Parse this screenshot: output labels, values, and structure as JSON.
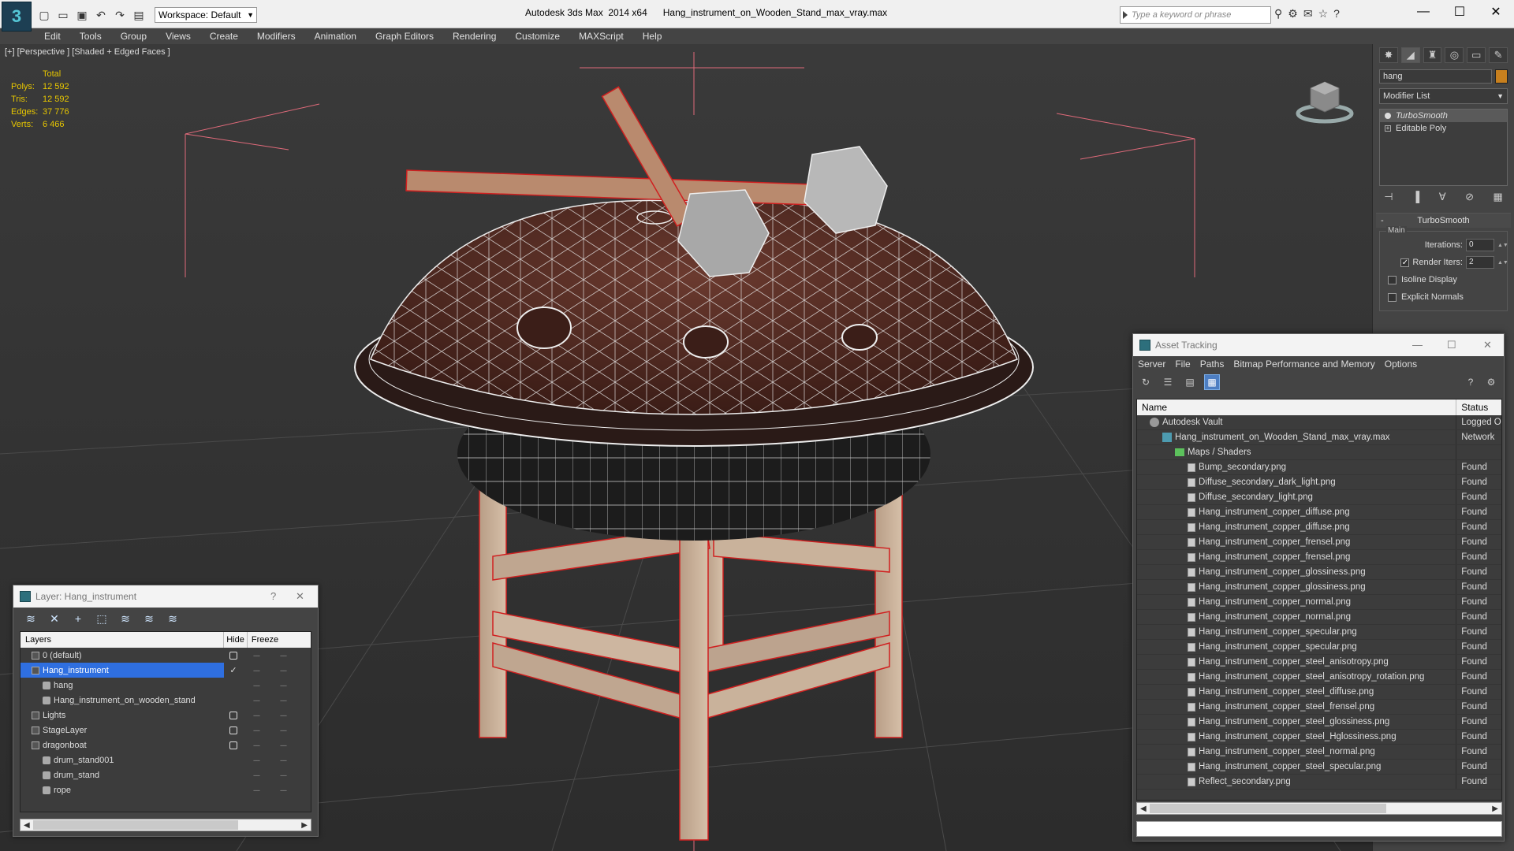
{
  "app": {
    "logo": "3",
    "workspace": "Workspace: Default",
    "title": "Autodesk 3ds Max  2014 x64      Hang_instrument_on_Wooden_Stand_max_vray.max",
    "search_placeholder": "Type a keyword or phrase"
  },
  "menu": [
    "Edit",
    "Tools",
    "Group",
    "Views",
    "Create",
    "Modifiers",
    "Animation",
    "Graph Editors",
    "Rendering",
    "Customize",
    "MAXScript",
    "Help"
  ],
  "viewport": {
    "label": "[+] [Perspective ] [Shaded + Edged Faces ]",
    "stats_header": "Total",
    "stats": [
      {
        "k": "Polys:",
        "v": "12 592"
      },
      {
        "k": "Tris:",
        "v": "12 592"
      },
      {
        "k": "Edges:",
        "v": "37 776"
      },
      {
        "k": "Verts:",
        "v": "6 466"
      }
    ]
  },
  "command_panel": {
    "object_name": "hang",
    "modifier_list": "Modifier List",
    "stack": [
      {
        "label": "TurboSmooth",
        "selected": true
      },
      {
        "label": "Editable Poly",
        "selected": false
      }
    ],
    "rollout_title": "TurboSmooth",
    "group_title": "Main",
    "iterations_label": "Iterations:",
    "iterations_value": "0",
    "render_iters_label": "Render Iters:",
    "render_iters_value": "2",
    "isoline_label": "Isoline Display",
    "explicit_normals_label": "Explicit Normals",
    "color_swatch": "#c8801e"
  },
  "layer_window": {
    "title": "Layer: Hang_instrument",
    "help": "?",
    "close": "✕",
    "col_layers": "Layers",
    "col_hide": "Hide",
    "col_freeze": "Freeze",
    "rows": [
      {
        "name": "0 (default)",
        "indent": 1,
        "type": "layer",
        "selected": false,
        "box": true
      },
      {
        "name": "Hang_instrument",
        "indent": 1,
        "type": "layer",
        "selected": true,
        "box": false,
        "check": true
      },
      {
        "name": "hang",
        "indent": 2,
        "type": "object",
        "selected": false,
        "box": false
      },
      {
        "name": "Hang_instrument_on_wooden_stand",
        "indent": 2,
        "type": "object",
        "selected": false,
        "box": false
      },
      {
        "name": "Lights",
        "indent": 1,
        "type": "layer",
        "selected": false,
        "box": true
      },
      {
        "name": "StageLayer",
        "indent": 1,
        "type": "layer",
        "selected": false,
        "box": true
      },
      {
        "name": "dragonboat",
        "indent": 1,
        "type": "layer",
        "selected": false,
        "box": true
      },
      {
        "name": "drum_stand001",
        "indent": 2,
        "type": "object",
        "selected": false,
        "box": false
      },
      {
        "name": "drum_stand",
        "indent": 2,
        "type": "object",
        "selected": false,
        "box": false
      },
      {
        "name": "rope",
        "indent": 2,
        "type": "object",
        "selected": false,
        "box": false
      }
    ]
  },
  "asset_window": {
    "title": "Asset Tracking",
    "menu": [
      "Server",
      "File",
      "Paths",
      "Bitmap Performance and Memory",
      "Options"
    ],
    "col_name": "Name",
    "col_status": "Status",
    "rows": [
      {
        "name": "Autodesk Vault",
        "status": "Logged O",
        "indent": 1,
        "icon": "vault"
      },
      {
        "name": "Hang_instrument_on_Wooden_Stand_max_vray.max",
        "status": "Network",
        "indent": 2,
        "icon": "max"
      },
      {
        "name": "Maps / Shaders",
        "status": "",
        "indent": 3,
        "icon": "group"
      },
      {
        "name": "Bump_secondary.png",
        "status": "Found",
        "indent": 4,
        "icon": "file"
      },
      {
        "name": "Diffuse_secondary_dark_light.png",
        "status": "Found",
        "indent": 4,
        "icon": "file"
      },
      {
        "name": "Diffuse_secondary_light.png",
        "status": "Found",
        "indent": 4,
        "icon": "file"
      },
      {
        "name": "Hang_instrument_copper_diffuse.png",
        "status": "Found",
        "indent": 4,
        "icon": "file"
      },
      {
        "name": "Hang_instrument_copper_diffuse.png",
        "status": "Found",
        "indent": 4,
        "icon": "file"
      },
      {
        "name": "Hang_instrument_copper_frensel.png",
        "status": "Found",
        "indent": 4,
        "icon": "file"
      },
      {
        "name": "Hang_instrument_copper_frensel.png",
        "status": "Found",
        "indent": 4,
        "icon": "file"
      },
      {
        "name": "Hang_instrument_copper_glossiness.png",
        "status": "Found",
        "indent": 4,
        "icon": "file"
      },
      {
        "name": "Hang_instrument_copper_glossiness.png",
        "status": "Found",
        "indent": 4,
        "icon": "file"
      },
      {
        "name": "Hang_instrument_copper_normal.png",
        "status": "Found",
        "indent": 4,
        "icon": "file"
      },
      {
        "name": "Hang_instrument_copper_normal.png",
        "status": "Found",
        "indent": 4,
        "icon": "file"
      },
      {
        "name": "Hang_instrument_copper_specular.png",
        "status": "Found",
        "indent": 4,
        "icon": "file"
      },
      {
        "name": "Hang_instrument_copper_specular.png",
        "status": "Found",
        "indent": 4,
        "icon": "file"
      },
      {
        "name": "Hang_instrument_copper_steel_anisotropy.png",
        "status": "Found",
        "indent": 4,
        "icon": "file"
      },
      {
        "name": "Hang_instrument_copper_steel_anisotropy_rotation.png",
        "status": "Found",
        "indent": 4,
        "icon": "file"
      },
      {
        "name": "Hang_instrument_copper_steel_diffuse.png",
        "status": "Found",
        "indent": 4,
        "icon": "file"
      },
      {
        "name": "Hang_instrument_copper_steel_frensel.png",
        "status": "Found",
        "indent": 4,
        "icon": "file"
      },
      {
        "name": "Hang_instrument_copper_steel_glossiness.png",
        "status": "Found",
        "indent": 4,
        "icon": "file"
      },
      {
        "name": "Hang_instrument_copper_steel_Hglossiness.png",
        "status": "Found",
        "indent": 4,
        "icon": "file"
      },
      {
        "name": "Hang_instrument_copper_steel_normal.png",
        "status": "Found",
        "indent": 4,
        "icon": "file"
      },
      {
        "name": "Hang_instrument_copper_steel_specular.png",
        "status": "Found",
        "indent": 4,
        "icon": "file"
      },
      {
        "name": "Reflect_secondary.png",
        "status": "Found",
        "indent": 4,
        "icon": "file"
      }
    ]
  }
}
